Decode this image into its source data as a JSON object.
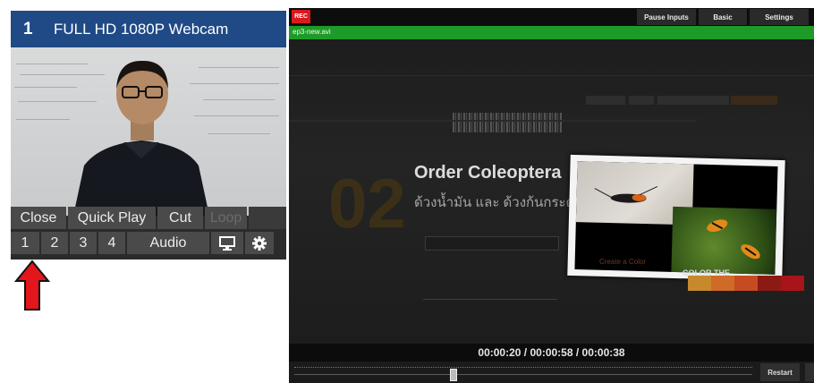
{
  "input": {
    "number": "1",
    "title": "FULL HD 1080P Webcam",
    "row1": [
      "Close",
      "Quick Play",
      "Cut",
      "Loop"
    ],
    "row2": [
      "1",
      "2",
      "3",
      "4",
      "Audio"
    ],
    "icons": [
      "monitor-icon",
      "gear-icon"
    ]
  },
  "app": {
    "rec_label": "REC",
    "top_buttons": [
      "Pause Inputs",
      "Basic",
      "Settings"
    ],
    "filename": "ep3-new.avi",
    "slide": {
      "number": "02",
      "title": "Order Coleoptera",
      "subtitle": "ด้วงน้ำมัน และ ด้วงก้นกระดก",
      "create_color": "Create a Color",
      "color_the": "COLOR THE"
    },
    "swatch_colors": [
      "#c68a2c",
      "#d06a28",
      "#c64b22",
      "#8c1a14",
      "#a8141a"
    ],
    "time": {
      "position": "00:00:20",
      "duration": "00:00:58",
      "total": "00:00:38",
      "sep": "/"
    },
    "restart_label": "Restart"
  },
  "colors": {
    "header_blue": "#1f4a86",
    "file_green": "#1e9a28",
    "arrow_red": "#e3161c"
  }
}
